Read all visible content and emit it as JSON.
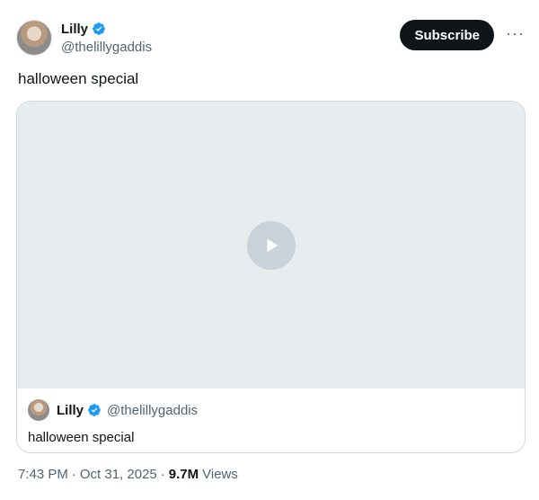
{
  "author": {
    "display_name": "Lilly",
    "handle": "@thelillygaddis"
  },
  "actions": {
    "subscribe_label": "Subscribe",
    "more_icon": "more-horizontal-icon"
  },
  "post": {
    "text": "halloween special"
  },
  "quoted_post": {
    "display_name": "Lilly",
    "handle": "@thelillygaddis",
    "text": "halloween special"
  },
  "meta": {
    "time": "7:43 PM",
    "date": "Oct 31, 2025",
    "views_count": "9.7M",
    "views_label": "Views",
    "separator": "·"
  },
  "colors": {
    "verified": "#1d9bf0",
    "text_primary": "#0f1419",
    "text_secondary": "#536471",
    "border": "#cfd9de"
  }
}
